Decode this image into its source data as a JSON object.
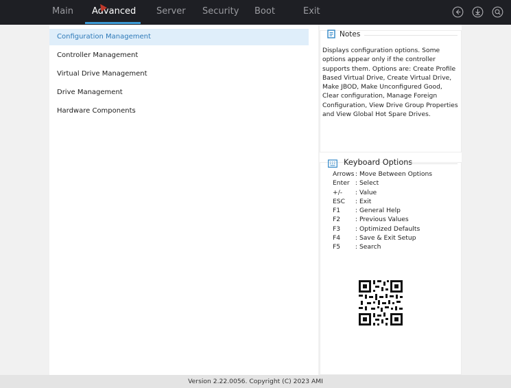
{
  "tabs": [
    {
      "label": "Main"
    },
    {
      "label": "Advanced"
    },
    {
      "label": "Server"
    },
    {
      "label": "Security"
    },
    {
      "label": "Boot"
    },
    {
      "label": "Exit"
    }
  ],
  "active_tab": "Advanced",
  "header_icons": [
    "back-icon",
    "download-icon",
    "search-icon"
  ],
  "menu": {
    "items": [
      {
        "label": "Configuration Management"
      },
      {
        "label": "Controller Management"
      },
      {
        "label": "Virtual Drive Management"
      },
      {
        "label": "Drive Management"
      },
      {
        "label": "Hardware Components"
      }
    ],
    "selected": "Configuration Management"
  },
  "notes": {
    "title": "Notes",
    "text": "Displays configuration options. Some options appear only if the controller supports them. Options are: Create Profile Based Virtual Drive, Create Virtual Drive, Make JBOD, Make Unconfigured Good, Clear configuration, Manage Foreign Configuration, View Drive Group Properties and View Global Hot Spare Drives."
  },
  "keyboard": {
    "title": "Keyboard Options",
    "rows": [
      {
        "key": "Arrows",
        "desc": ": Move Between Options"
      },
      {
        "key": "Enter",
        "desc": ": Select"
      },
      {
        "key": "+/-",
        "desc": ": Value"
      },
      {
        "key": "ESC",
        "desc": ": Exit"
      },
      {
        "key": "F1",
        "desc": ": General Help"
      },
      {
        "key": "F2",
        "desc": ": Previous Values"
      },
      {
        "key": "F3",
        "desc": ": Optimized Defaults"
      },
      {
        "key": "F4",
        "desc": ": Save & Exit Setup"
      },
      {
        "key": "F5",
        "desc": ": Search"
      }
    ]
  },
  "footer": {
    "version": "Version 2.22.0056. Copyright (C) 2023 AMI"
  },
  "colors": {
    "topbar": "#1e1f24",
    "accent": "#3d9bd6",
    "selected_bg": "#dfeefa",
    "selected_text": "#2d79b8"
  }
}
